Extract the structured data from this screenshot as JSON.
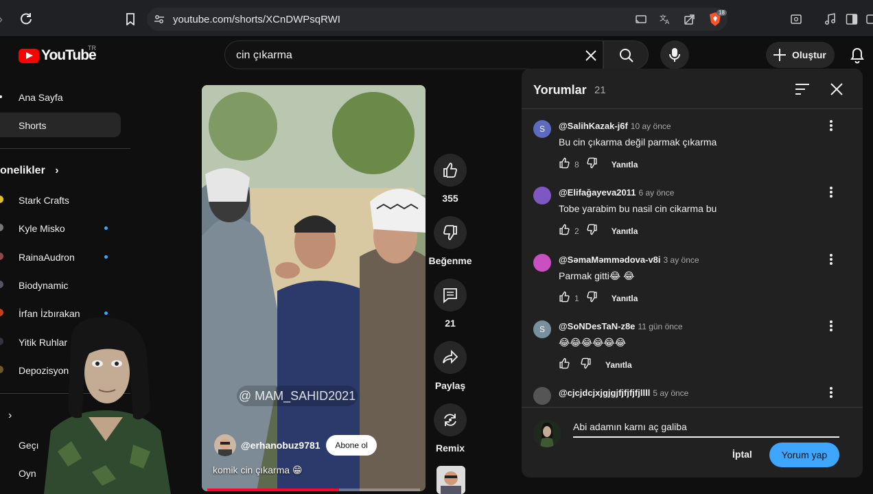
{
  "browser": {
    "url": "youtube.com/shorts/XCnDWPsqRWI",
    "brave_badge": "18"
  },
  "header": {
    "logo_text": "YouTube",
    "country_code": "TR",
    "search_query": "cin çıkarma",
    "create_label": "Oluştur"
  },
  "sidebar": {
    "home_label": "Ana Sayfa",
    "shorts_label": "Shorts",
    "subscriptions_label": "onelikler",
    "channels": [
      {
        "name": "Stark Crafts",
        "new": false,
        "color": "#e0c020"
      },
      {
        "name": "Kyle Misko",
        "new": true,
        "color": "#777"
      },
      {
        "name": "RainaAudron",
        "new": true,
        "color": "#8c4a4a"
      },
      {
        "name": "Biodynamic",
        "new": false,
        "color": "#556"
      },
      {
        "name": "İrfan İzbırakan",
        "new": true,
        "color": "#c04020"
      },
      {
        "name": "Yitik Ruhlar",
        "new": false,
        "color": "#334"
      },
      {
        "name": "Depozisyon",
        "new": false,
        "color": "#6a5a2a"
      }
    ],
    "more_1": "Geçı",
    "more_2": "Oyn"
  },
  "video": {
    "watermark": "@ MAM_SAHID2021",
    "channel": "@erhanobuz9781",
    "subscribe_label": "Abone ol",
    "caption": "komik cin çıkarma 😁",
    "progress": 0.62
  },
  "actions": {
    "likes": "355",
    "dislike_label": "Beğenme",
    "comments": "21",
    "share_label": "Paylaş",
    "remix_label": "Remix"
  },
  "comments_panel": {
    "title": "Yorumlar",
    "count": "21",
    "comments": [
      {
        "avatar_letter": "S",
        "avatar_color": "#5c6bc0",
        "user": "@SalihKazak-j6f",
        "time": "10 ay önce",
        "text": "Bu cin çıkarma değil parmak çıkarma",
        "likes": "8",
        "reply": "Yanıtla"
      },
      {
        "avatar_letter": "",
        "avatar_color": "#7e57c2",
        "user": "@Elifağayeva2011",
        "time": "6 ay önce",
        "text": "Tobe yarabim bu nasil cin cikarma bu",
        "likes": "2",
        "reply": "Yanıtla"
      },
      {
        "avatar_letter": "",
        "avatar_color": "#c850c0",
        "user": "@SəmaMəmmədova-v8i",
        "time": "3 ay önce",
        "text": "Parmak gitti😂 😂",
        "likes": "1",
        "reply": "Yanıtla"
      },
      {
        "avatar_letter": "S",
        "avatar_color": "#78909c",
        "user": "@SoNDesTaN-z8e",
        "time": "11 gün önce",
        "text": "😂😂😂😂😂😂",
        "likes": "",
        "reply": "Yanıtla"
      },
      {
        "avatar_letter": "",
        "avatar_color": "#555",
        "user": "@cjcjdcjxjgjgjfjfjfjfjllll",
        "time": "5 ay önce",
        "text": "",
        "likes": "",
        "reply": ""
      }
    ],
    "draft": "Abi adamın karnı aç galiba",
    "cancel_label": "İptal",
    "post_label": "Yorum yap"
  }
}
